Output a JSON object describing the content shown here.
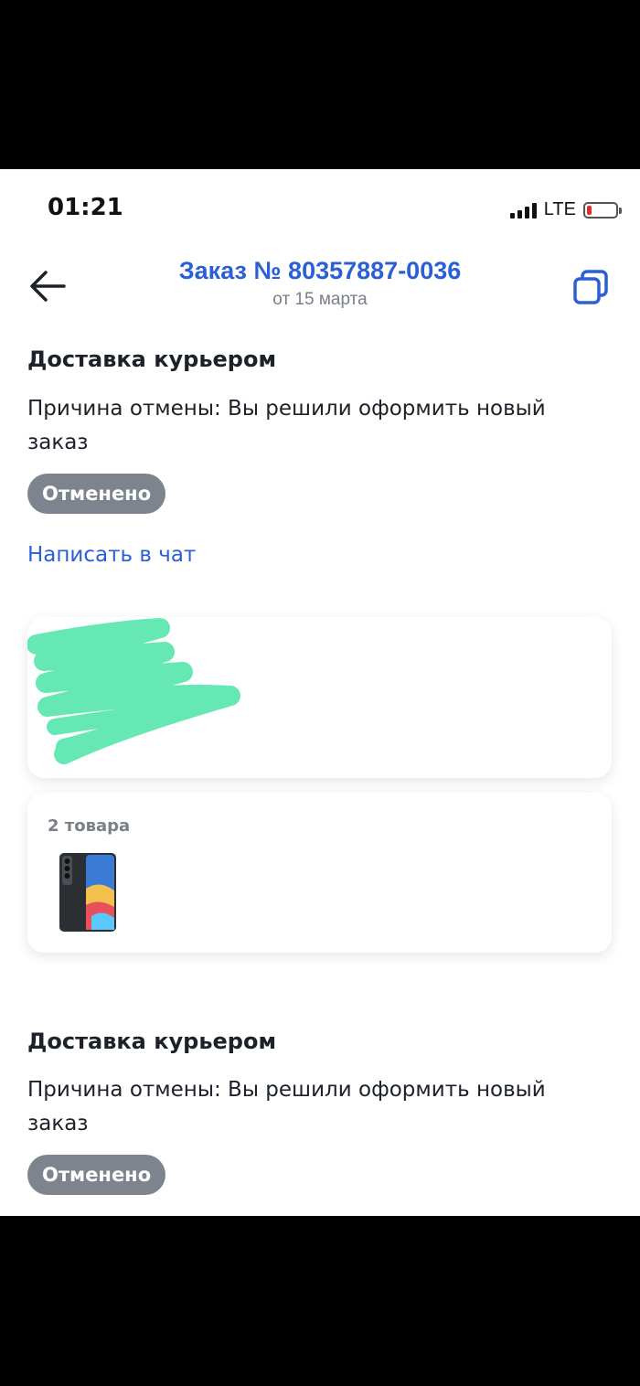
{
  "status_bar": {
    "time": "01:21",
    "network": "LTE"
  },
  "header": {
    "title": "Заказ № 80357887-0036",
    "subtitle": "от 15 марта"
  },
  "deliveries": [
    {
      "title": "Доставка курьером",
      "reason": "Причина отмены: Вы решили оформить новый заказ",
      "status": "Отменено"
    },
    {
      "title": "Доставка курьером",
      "reason": "Причина отмены: Вы решили оформить новый заказ",
      "status": "Отменено"
    }
  ],
  "chat_link": "Написать в чат",
  "items_card": {
    "count_label": "2 товара"
  },
  "colors": {
    "accent": "#2a5fd6",
    "badge": "#7e848d",
    "redaction": "#66e8b4"
  }
}
